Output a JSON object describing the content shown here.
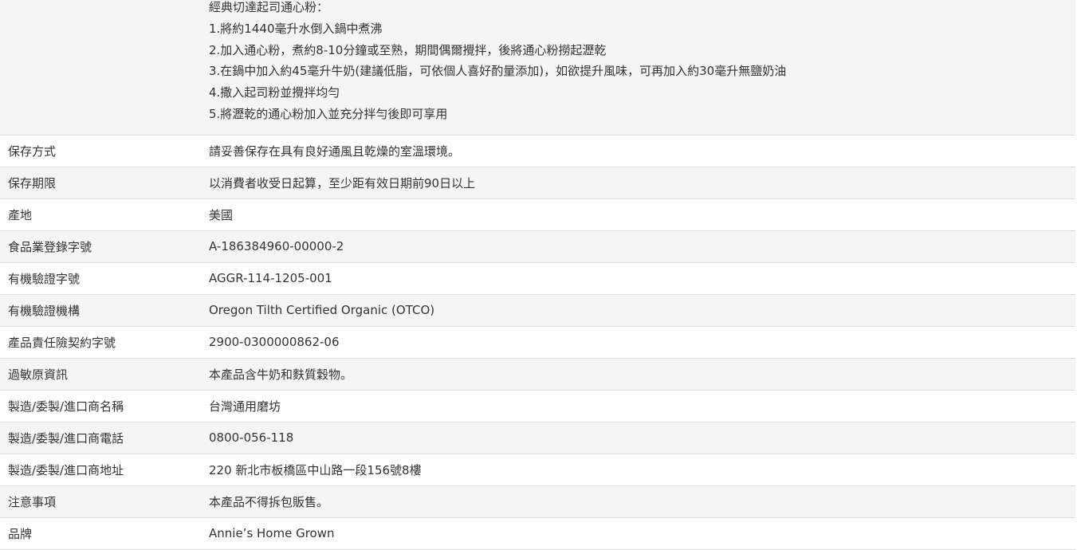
{
  "recipe": {
    "title": "經典切達起司通心粉：",
    "steps": [
      "1.將約1440毫升水倒入鍋中煮沸",
      "2.加入通心粉，煮約8-10分鐘或至熟，期間偶爾攪拌，後將通心粉撈起瀝乾",
      "3.在鍋中加入約45毫升牛奶(建議低脂，可依個人喜好酌量添加)，如欲提升風味，可再加入約30毫升無鹽奶油",
      "4.撒入起司粉並攪拌均勻",
      "5.將瀝乾的通心粉加入並充分拌勻後即可享用"
    ]
  },
  "rows": [
    {
      "label": "保存方式",
      "value": "請妥善保存在具有良好通風且乾燥的室溫環境。"
    },
    {
      "label": "保存期限",
      "value": "以消費者收受日起算，至少距有效日期前90日以上"
    },
    {
      "label": "產地",
      "value": "美國"
    },
    {
      "label": "食品業登錄字號",
      "value": "A-186384960-00000-2"
    },
    {
      "label": "有機驗證字號",
      "value": "AGGR-114-1205-001"
    },
    {
      "label": "有機驗證機構",
      "value": "Oregon Tilth Certified Organic (OTCO)"
    },
    {
      "label": "產品責任險契約字號",
      "value": "2900-0300000862-06"
    },
    {
      "label": "過敏原資訊",
      "value": "本產品含牛奶和麩質穀物。"
    },
    {
      "label": "製造/委製/進口商名稱",
      "value": "台灣通用磨坊"
    },
    {
      "label": "製造/委製/進口商電話",
      "value": "0800-056-118"
    },
    {
      "label": "製造/委製/進口商地址",
      "value": "220 新北市板橋區中山路一段156號8樓"
    },
    {
      "label": "注意事項",
      "value": "本產品不得拆包販售。"
    },
    {
      "label": "品牌",
      "value": "Annie’s Home Grown"
    }
  ]
}
